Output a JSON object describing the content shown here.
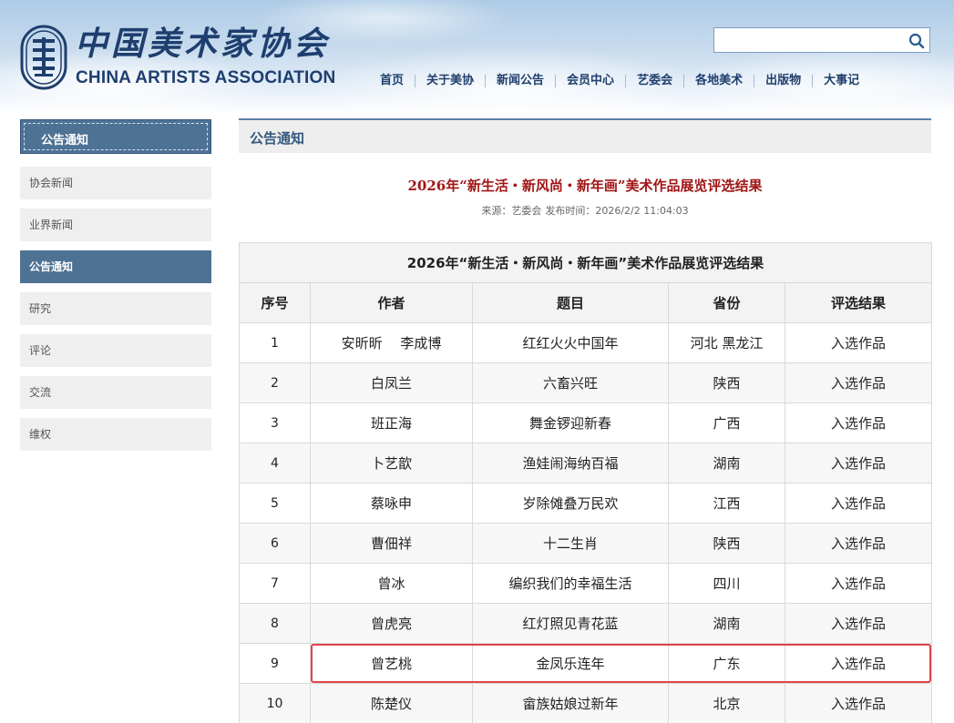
{
  "header": {
    "logo_cn": "中国美术家协会",
    "logo_en": "CHINA ARTISTS ASSOCIATION",
    "search": {
      "value": "",
      "placeholder": ""
    },
    "nav": [
      "首页",
      "关于美协",
      "新闻公告",
      "会员中心",
      "艺委会",
      "各地美术",
      "出版物",
      "大事记"
    ]
  },
  "sidebar": {
    "title": "公告通知",
    "items": [
      {
        "label": "协会新闻",
        "active": false
      },
      {
        "label": "业界新闻",
        "active": false
      },
      {
        "label": "公告通知",
        "active": true
      },
      {
        "label": "研究",
        "active": false
      },
      {
        "label": "评论",
        "active": false
      },
      {
        "label": "交流",
        "active": false
      },
      {
        "label": "维权",
        "active": false
      }
    ]
  },
  "main": {
    "section_title": "公告通知",
    "article": {
      "title": "2026年“新生活・新风尚・新年画”美术作品展览评选结果",
      "source": "来源：艺委会",
      "publish_time": "发布时间：2026/2/2 11:04:03"
    },
    "table": {
      "caption": "2026年“新生活・新风尚・新年画”美术作品展览评选结果",
      "headers": [
        "序号",
        "作者",
        "题目",
        "省份",
        "评选结果"
      ],
      "rows": [
        [
          "1",
          "安昕昕　 李成博",
          "红红火火中国年",
          "河北  黑龙江",
          "入选作品"
        ],
        [
          "2",
          "白凤兰",
          "六畜兴旺",
          "陕西",
          "入选作品"
        ],
        [
          "3",
          "班正海",
          "舞金锣迎新春",
          "广西",
          "入选作品"
        ],
        [
          "4",
          "卜艺歆",
          "渔娃闹海纳百福",
          "湖南",
          "入选作品"
        ],
        [
          "5",
          "蔡咏申",
          "岁除傩叠万民欢",
          "江西",
          "入选作品"
        ],
        [
          "6",
          "曹佃祥",
          "十二生肖",
          "陕西",
          "入选作品"
        ],
        [
          "7",
          "曾冰",
          "编织我们的幸福生活",
          "四川",
          "入选作品"
        ],
        [
          "8",
          "曾虎亮",
          "红灯照见青花蓝",
          "湖南",
          "入选作品"
        ],
        [
          "9",
          "曾艺桃",
          "金凤乐连年",
          "广东",
          "入选作品"
        ],
        [
          "10",
          "陈楚仪",
          "畲族姑娘过新年",
          "北京",
          "入选作品"
        ]
      ],
      "highlighted_row": 9,
      "highlight_color": "#e0434a"
    }
  },
  "colors": {
    "brand_navy": "#1e3e6e",
    "sidebar_active": "#4e7294",
    "article_title": "#a11515"
  }
}
